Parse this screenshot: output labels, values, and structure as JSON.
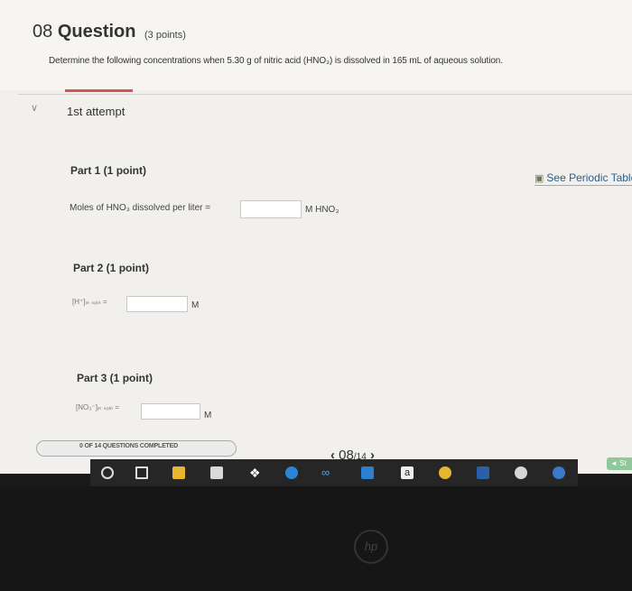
{
  "question": {
    "number": "08",
    "title": "Question",
    "points": "(3 points)",
    "prompt": "Determine the following concentrations when 5.30 g of nitric acid (HNO₃) is dissolved in 165 mL of aqueous solution."
  },
  "attempt": {
    "label": "1st attempt",
    "chevron": "chevron-down-icon"
  },
  "periodic_table": {
    "label": "See Periodic Table",
    "icon": "chart-icon"
  },
  "parts": [
    {
      "title": "Part 1   (1 point)",
      "label": "Moles of HNO₃ dissolved per liter =",
      "value": "",
      "unit": "M HNO₃"
    },
    {
      "title": "Part 2   (1 point)",
      "label": "[H⁺]ᵢₙ ₛₒₗₙ =",
      "value": "",
      "unit": "M"
    },
    {
      "title": "Part 3   (1 point)",
      "label": "[NO₃⁻]ᵢₙ ₛₒₗₙ =",
      "value": "",
      "unit": "M"
    }
  ],
  "progress": {
    "text": "0 OF 14 QUESTIONS COMPLETED",
    "fraction": 0.0
  },
  "pager": {
    "prev": "‹",
    "current": "08",
    "total": "/14",
    "next": "›"
  },
  "side_button": {
    "label": "◄ St"
  },
  "taskbar": {
    "icons": [
      "circle-icon",
      "task-view-icon",
      "file-explorer-icon",
      "store-icon",
      "dropbox-icon",
      "edge-icon",
      "infinity-icon",
      "mail-icon",
      "amazon-icon",
      "chrome-icon",
      "word-icon",
      "music-icon",
      "app-icon"
    ],
    "amazon_label": "a"
  },
  "logo": "hp"
}
